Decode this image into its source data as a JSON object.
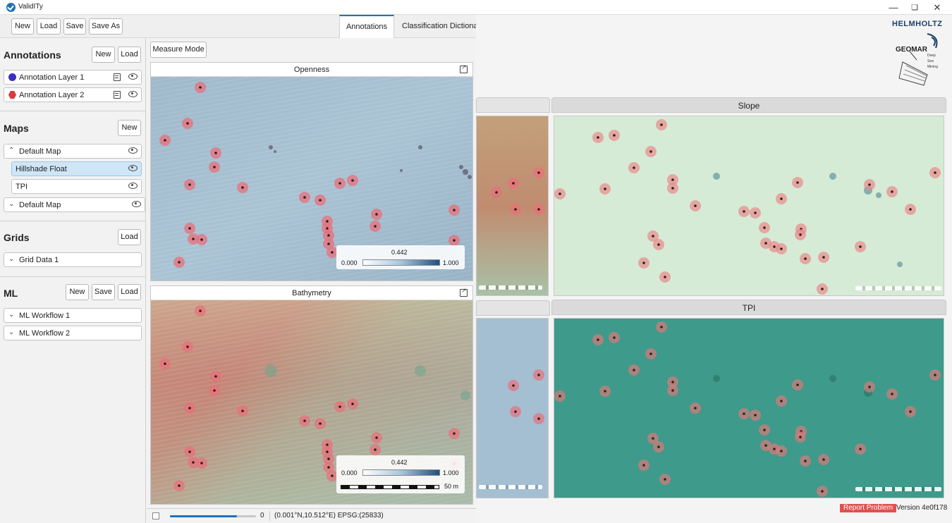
{
  "window": {
    "title": "ValidITy"
  },
  "toolbar": {
    "buttons": [
      "New",
      "Load",
      "Save",
      "Save As"
    ]
  },
  "tabs": [
    {
      "label": "Annotations"
    },
    {
      "label": "Classification Dictionary"
    }
  ],
  "sidebar": {
    "annotations": {
      "title": "Annotations",
      "buttons": [
        "New",
        "Load"
      ],
      "layers": [
        {
          "label": "Annotation Layer 1",
          "color": "#3a2fbf"
        },
        {
          "label": "Annotation Layer 2",
          "color": "#d93a3a"
        }
      ]
    },
    "maps": {
      "title": "Maps",
      "button": "New",
      "groups": [
        {
          "label": "Default Map",
          "expanded": true,
          "children": [
            "Hillshade Float",
            "TPI"
          ]
        },
        {
          "label": "Default Map",
          "expanded": false,
          "children": []
        }
      ]
    },
    "grids": {
      "title": "Grids",
      "button": "Load",
      "items": [
        "Grid Data 1"
      ]
    },
    "ml": {
      "title": "ML",
      "buttons": [
        "New",
        "Save",
        "Load"
      ],
      "items": [
        "ML Workflow 1",
        "ML Workflow 2"
      ]
    }
  },
  "main": {
    "measure_mode": "Measure Mode",
    "panels": [
      {
        "title": "Openness",
        "cbar_min": "0.000",
        "cbar_mid": "0.442",
        "cbar_max": "1.000"
      },
      {
        "title": "Bathymetry",
        "cbar_min": "0.000",
        "cbar_mid": "0.442",
        "cbar_max": "1.000",
        "scale_label": "50 m"
      }
    ]
  },
  "status": {
    "value": "0",
    "coords": "(0.001°N,10.512°E) EPSG:(25833)",
    "progress": 0.78
  },
  "right": {
    "logo_line1": "HELMHOLTZ",
    "logo_line2": "GEOMAR",
    "logo_small": [
      "Deep",
      "Sea",
      "Mining"
    ],
    "panels": [
      {
        "title": "Slope"
      },
      {
        "title": "TPI"
      }
    ],
    "report_button": "Report Problem",
    "version": "Version 4e0f178"
  },
  "colors": {
    "accent": "#1e73b8",
    "marker": "#e8707a",
    "selection": "#cfe6f7"
  }
}
